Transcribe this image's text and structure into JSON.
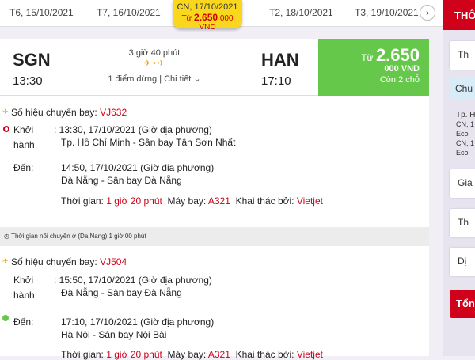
{
  "date_bar": {
    "tabs": [
      "T6, 15/10/2021",
      "T7, 16/10/2021",
      "T2, 18/10/2021",
      "T3, 19/10/2021"
    ],
    "selected_date": "CN, 17/10/2021",
    "selected_prefix": "Từ",
    "selected_price": "2.650",
    "selected_price_suffix": "000 VND",
    "next_icon": "chevron-right-icon"
  },
  "flight_summary": {
    "from_code": "SGN",
    "from_time": "13:30",
    "to_code": "HAN",
    "to_time": "17:10",
    "duration": "3 giờ 40 phút",
    "stops": "1 điểm dừng | Chi tiết",
    "price_prefix": "Từ",
    "price": "2.650",
    "price_unit": "000 VND",
    "seats_left": "Còn 2 chỗ"
  },
  "segment1": {
    "label": "Số hiệu chuyến bay:",
    "flight_no": "VJ632",
    "depart_label1": "Khởi",
    "depart_label2": "hành",
    "depart_time": ": 13:30, 17/10/2021 (Giờ địa phương)",
    "depart_place": "Tp. Hồ Chí Minh - Sân bay Tân Sơn Nhất",
    "arrive_label": "Đến:",
    "arrive_time": "14:50, 17/10/2021 (Giờ địa phương)",
    "arrive_place": "Đà Nẵng - Sân bay Đà Nẵng",
    "time_label": "Thời gian:",
    "time_value": "1 giờ 20 phút",
    "aircraft_label": "Máy bay:",
    "aircraft_value": "A321",
    "operator_label": "Khai thác bởi:",
    "operator_value": "Vietjet"
  },
  "connection": "Thời gian nối chuyến ở (Da Nang) 1 giờ 00 phút",
  "segment2": {
    "label": "Số hiệu chuyến bay:",
    "flight_no": "VJ504",
    "depart_label1": "Khởi",
    "depart_label2": "hành",
    "depart_time": ": 15:50, 17/10/2021 (Giờ địa phương)",
    "depart_place": "Đà Nẵng - Sân bay Đà Nẵng",
    "arrive_label": "Đến:",
    "arrive_time": "17:10, 17/10/2021 (Giờ địa phương)",
    "arrive_place": "Hà Nội - Sân bay Nội Bài",
    "time_label": "Thời gian:",
    "time_value": "1 giờ 20 phút",
    "aircraft_label": "Máy bay:",
    "aircraft_value": "A321",
    "operator_label": "Khai thác bởi:",
    "operator_value": "Vietjet"
  },
  "side_panel": {
    "header": "THÔ",
    "box1": "Th",
    "blue": "Chu",
    "small_title": "Tp. H",
    "small_lines": [
      "CN, 1",
      "Eco",
      "CN, 1",
      "Eco"
    ],
    "box2": "Gia",
    "box3": "Th",
    "box4": "Dị",
    "footer": "Tổng"
  },
  "colors": {
    "accent_red": "#d0021b",
    "price_green": "#66c84b",
    "date_yellow": "#f9d71c"
  }
}
